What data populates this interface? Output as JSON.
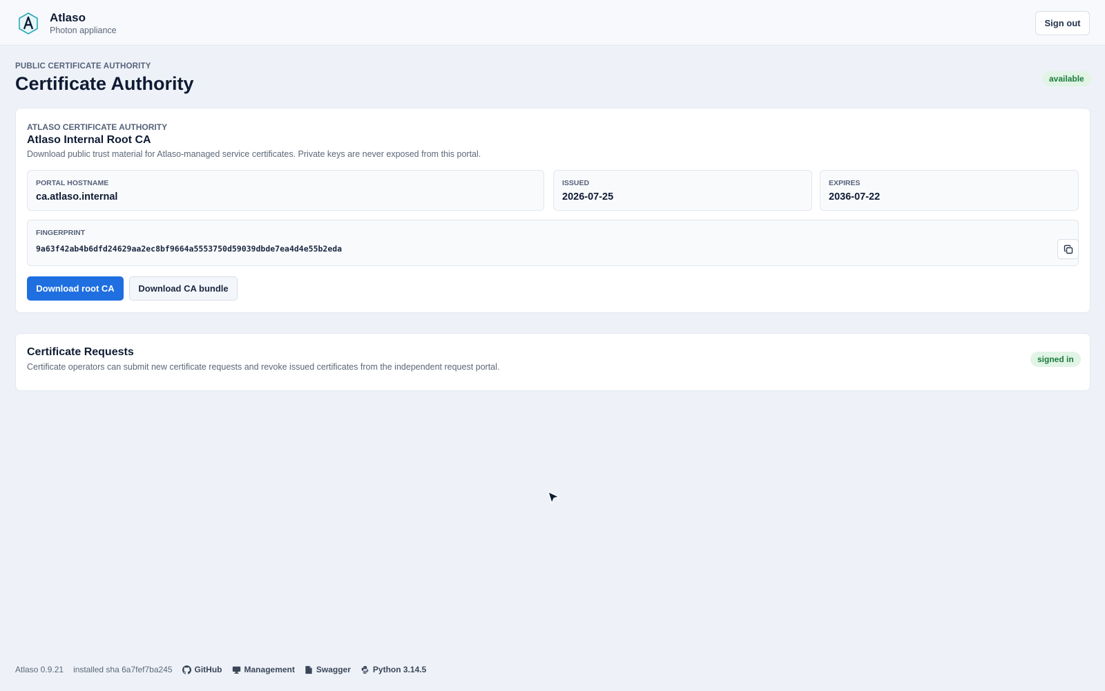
{
  "header": {
    "brand_name": "Atlaso",
    "brand_subtitle": "Photon appliance",
    "sign_out_label": "Sign out"
  },
  "page": {
    "eyebrow": "PUBLIC CERTIFICATE AUTHORITY",
    "title": "Certificate Authority",
    "status": "available"
  },
  "ca_card": {
    "eyebrow": "ATLASO CERTIFICATE AUTHORITY",
    "title": "Atlaso Internal Root CA",
    "description": "Download public trust material for Atlaso-managed service certificates. Private keys are never exposed from this portal.",
    "portal_hostname_label": "PORTAL HOSTNAME",
    "portal_hostname": "ca.atlaso.internal",
    "issued_label": "ISSUED",
    "issued": "2026-07-25",
    "expires_label": "EXPIRES",
    "expires": "2036-07-22",
    "fingerprint_label": "FINGERPRINT",
    "fingerprint": "9a63f42ab4b6dfd24629aa2ec8bf9664a5553750d59039dbde7ea4d4e55b2eda",
    "download_root_label": "Download root CA",
    "download_bundle_label": "Download CA bundle"
  },
  "requests_card": {
    "title": "Certificate Requests",
    "description": "Certificate operators can submit new certificate requests and revoke issued certificates from the independent request portal.",
    "status": "signed in"
  },
  "footer": {
    "version": "Atlaso 0.9.21",
    "sha": "installed sha 6a7fef7ba245",
    "links": [
      {
        "label": "GitHub",
        "icon": "github-icon"
      },
      {
        "label": "Management",
        "icon": "monitor-icon"
      },
      {
        "label": "Swagger",
        "icon": "document-icon"
      },
      {
        "label": "Python 3.14.5",
        "icon": "python-icon"
      }
    ]
  },
  "colors": {
    "accent": "#1f6fe0",
    "success_bg": "#e1f4e6",
    "success_text": "#1a7a3a",
    "background": "#eef2f8"
  }
}
